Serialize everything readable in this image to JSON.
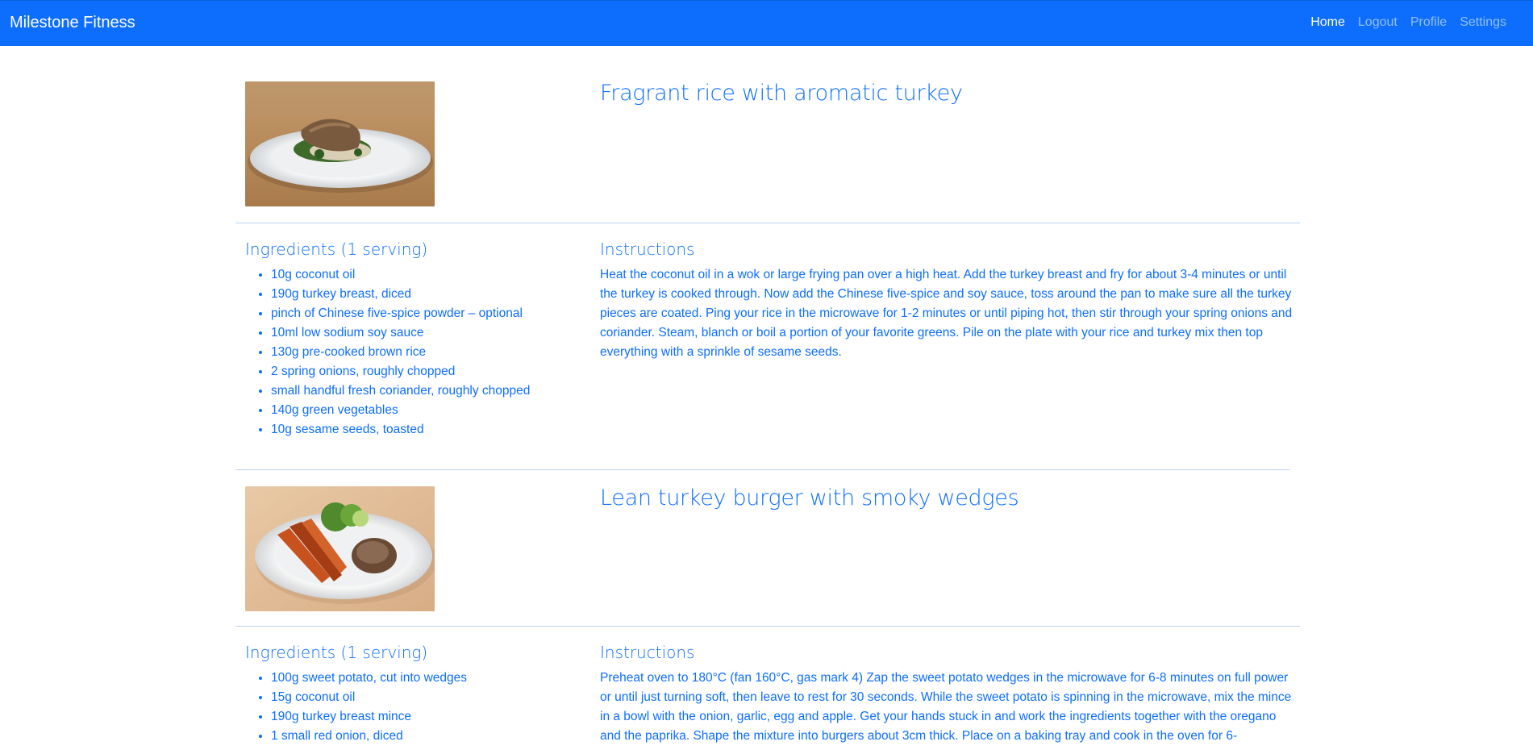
{
  "navbar": {
    "brand": "Milestone Fitness",
    "links": [
      {
        "label": "Home",
        "active": true
      },
      {
        "label": "Logout",
        "active": false
      },
      {
        "label": "Profile",
        "active": false
      },
      {
        "label": "Settings",
        "active": false
      }
    ]
  },
  "colors": {
    "primary": "#0d6efd",
    "divider": "#bcd3f6"
  },
  "recipes": [
    {
      "title": "Fragrant rice with aromatic turkey",
      "ingredients_heading": "Ingredients (1 serving)",
      "instructions_heading": "Instructions",
      "ingredients": [
        "10g coconut oil",
        "190g turkey breast, diced",
        "pinch of Chinese five-spice powder – optional",
        "10ml low sodium soy sauce",
        "130g pre-cooked brown rice",
        "2 spring onions, roughly chopped",
        "small handful fresh coriander, roughly chopped",
        "140g green vegetables",
        "10g sesame seeds, toasted"
      ],
      "instructions": "Heat the coconut oil in a wok or large frying pan over a high heat. Add the turkey breast and fry for about 3-4 minutes or until the turkey is cooked through. Now add the Chinese five-spice and soy sauce, toss around the pan to make sure all the turkey pieces are coated. Ping your rice in the microwave for 1-2 minutes or until piping hot, then stir through your spring onions and coriander. Steam, blanch or boil a portion of your favorite greens. Pile on the plate with your rice and turkey mix then top everything with a sprinkle of sesame seeds."
    },
    {
      "title": "Lean turkey burger with smoky wedges",
      "ingredients_heading": "Ingredients (1 serving)",
      "instructions_heading": "Instructions",
      "ingredients": [
        "100g sweet potato, cut into wedges",
        "15g coconut oil",
        "190g turkey breast mince",
        "1 small red onion, diced"
      ],
      "instructions": "Preheat oven to 180°C (fan 160°C, gas mark 4) Zap the sweet potato wedges in the microwave for 6-8 minutes on full power or until just turning soft, then leave to rest for 30 seconds. While the sweet potato is spinning in the microwave, mix the mince in a bowl with the onion, garlic, egg and apple. Get your hands stuck in and work the ingredients together with the oregano and the paprika. Shape the mixture into burgers about 3cm thick. Place on a baking tray and cook in the oven for 6-"
    }
  ]
}
